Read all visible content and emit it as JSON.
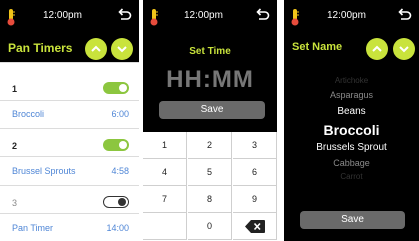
{
  "colors": {
    "accent": "#c9e33c",
    "link": "#4f86d6",
    "toggle_on": "#8cc63f",
    "bg": "#000000"
  },
  "status": {
    "time": "12:00pm"
  },
  "pan_timers": {
    "title": "Pan Timers",
    "timers": [
      {
        "number": "1",
        "name": "Broccoli",
        "value": "6:00",
        "enabled": true
      },
      {
        "number": "2",
        "name": "Brussel Sprouts",
        "value": "4:58",
        "enabled": true
      },
      {
        "number": "3",
        "name": "Pan Timer",
        "value": "14:00",
        "enabled": false
      }
    ]
  },
  "set_time": {
    "title": "Set Time",
    "placeholder": "HH:MM",
    "save_label": "Save",
    "keys": [
      "1",
      "2",
      "3",
      "4",
      "5",
      "6",
      "7",
      "8",
      "9",
      "0"
    ]
  },
  "set_name": {
    "title": "Set Name",
    "options": [
      "Artichoke",
      "Asparagus",
      "Beans",
      "Broccoli",
      "Brussels Sprout",
      "Cabbage",
      "Carrot"
    ],
    "selected": "Broccoli",
    "save_label": "Save"
  }
}
